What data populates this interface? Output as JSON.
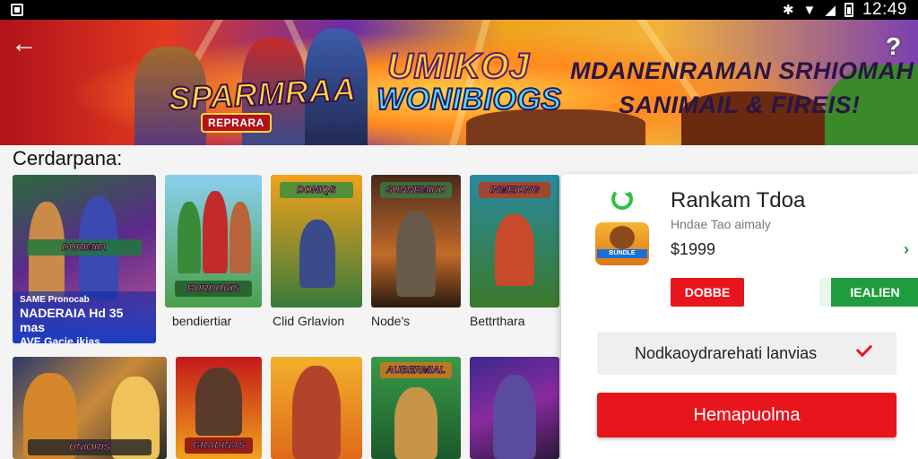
{
  "status_bar": {
    "time": "12:49"
  },
  "banner": {
    "title_left": "SPARMRAA",
    "title_left_sub": "REPRARA",
    "title_center_line1": "UMIKOJ",
    "title_center_line2": "WONIBIOGS",
    "title_right_line1": "MDANENRAMAN SRHIOMAH",
    "title_right_line2": "SANIMAIL & FIREIS!"
  },
  "section": {
    "label": "Cerdarpana:"
  },
  "featured_tile": {
    "logo": "DURIMIIA",
    "line1": "SAME Pronocab",
    "line2": "NADERAIA Hd 35 mas",
    "line3": "AVE Gacie ikias"
  },
  "tiles_row1": [
    {
      "caption": "bendiertiar",
      "logo": "BURDOKIS"
    },
    {
      "caption": "Clid Grlavion",
      "logo": "DONIQS"
    },
    {
      "caption": "Node's",
      "logo": "SUNNEMIKO"
    },
    {
      "caption": "Bettrthara",
      "logo": "INMEIONG"
    }
  ],
  "tiles_row2": [
    {
      "logo": "UNIORIS"
    },
    {
      "logo": "GRADINAS"
    },
    {
      "logo": ""
    },
    {
      "logo": "AUBERMIAL"
    },
    {
      "logo": ""
    }
  ],
  "detail": {
    "title": "Rankam Tdoa",
    "subtitle": "Hndae Tao aimaly",
    "price": "$1999",
    "icon_label": "BUNDLE",
    "btn_left": "DOBBE",
    "btn_right": "IEALIEN",
    "option_text": "Nodkaoydrarehati lanvias",
    "primary_btn": "Hemapuolma"
  },
  "colors": {
    "accent_red": "#e8151d",
    "accent_green": "#1f9c3e"
  }
}
